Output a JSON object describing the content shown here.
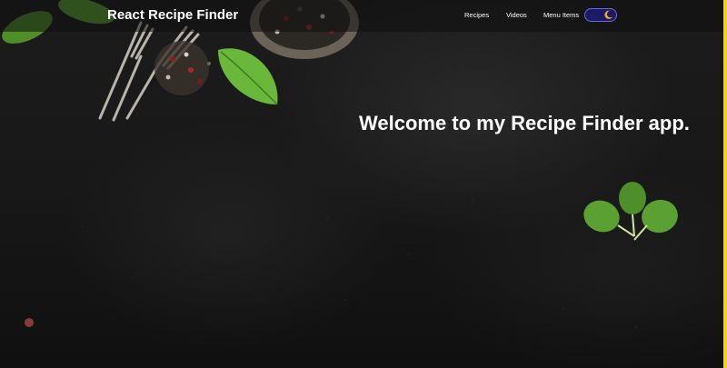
{
  "navbar": {
    "brand": "React Recipe Finder",
    "links": [
      "Recipes",
      "Videos",
      "Menu Items"
    ],
    "theme_toggle_icon": "moon-icon"
  },
  "hero": {
    "welcome": "Welcome to my Recipe Finder app."
  },
  "colors": {
    "background": "#141414",
    "toggle_bg": "#1a1a66",
    "moon": "#f5a623",
    "edge_accent": "#f2d21e",
    "leaf": "#6bb53b"
  }
}
